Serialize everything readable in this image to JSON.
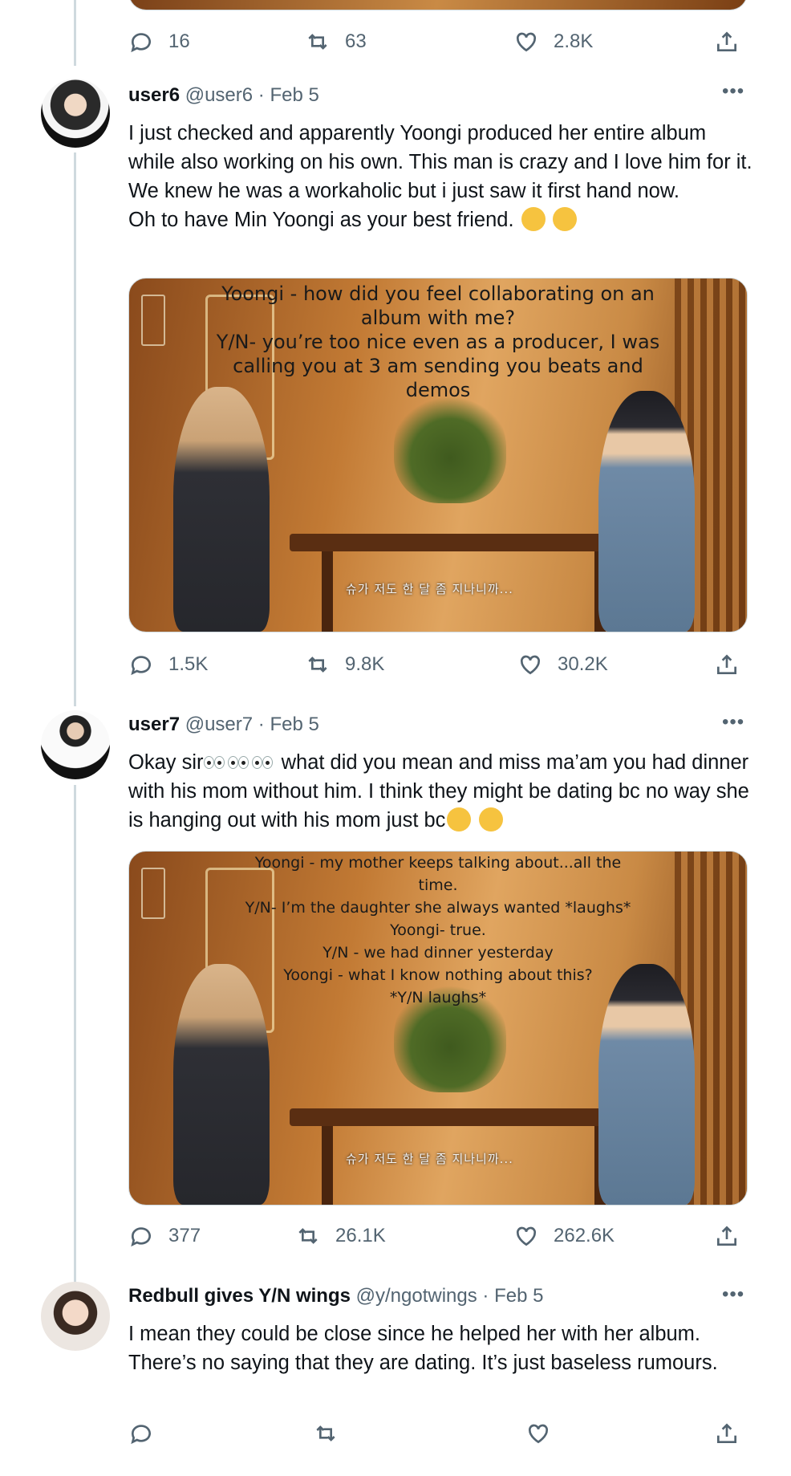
{
  "tweets": [
    {
      "actions": {
        "replies": "16",
        "retweets": "63",
        "likes": "2.8K"
      }
    },
    {
      "name": "user6",
      "handle": "@user6",
      "date": "Feb 5",
      "text_lines": [
        "I just checked and apparently Yoongi produced her entire album while also working on his own. This man is crazy and I love him for it.",
        "We knew he was a workaholic but i just saw it first hand now.",
        "Oh to have Min Yoongi as your best friend."
      ],
      "image_caption": [
        "Yoongi - how did you feel collaborating on an",
        "album with me?",
        "Y/N- you’re too nice even as a producer, I was",
        "calling you at 3 am sending you beats and",
        "demos"
      ],
      "image_subtitle": "슈가  저도 한 달 좀 지나니까...",
      "actions": {
        "replies": "1.5K",
        "retweets": "9.8K",
        "likes": "30.2K"
      }
    },
    {
      "name": "user7",
      "handle": "@user7",
      "date": "Feb 5",
      "text_start": "Okay sir",
      "text_rest": " what did you mean and miss ma’am you had dinner with his mom without him. I think they might be dating bc no way she is hanging out with his mom just bc",
      "image_caption": [
        "Yoongi - my mother keeps talking about...all the",
        "time.",
        "Y/N- I’m the daughter she always wanted *laughs*",
        "Yoongi- true.",
        "Y/N - we had dinner yesterday",
        "Yoongi - what I know nothing about this?",
        "*Y/N laughs*"
      ],
      "image_subtitle": "슈가  저도 한 달 좀 지나니까...",
      "actions": {
        "replies": "377",
        "retweets": "26.1K",
        "likes": "262.6K"
      }
    },
    {
      "name": "Redbull gives Y/N wings",
      "handle": "@y/ngotwings",
      "date": "Feb 5",
      "text": "I mean they could be close since he helped her with her album. There’s no saying that they are dating. It’s just baseless rumours."
    }
  ],
  "icons": {
    "reply": "reply-icon",
    "retweet": "retweet-icon",
    "like": "heart-icon",
    "share": "share-icon",
    "more": "more-icon"
  },
  "more_glyph": "•••",
  "separator": "·",
  "colors": {
    "secondary_text": "#536471",
    "thread_line": "#cfd9de",
    "emoji": "#f6c33f"
  }
}
